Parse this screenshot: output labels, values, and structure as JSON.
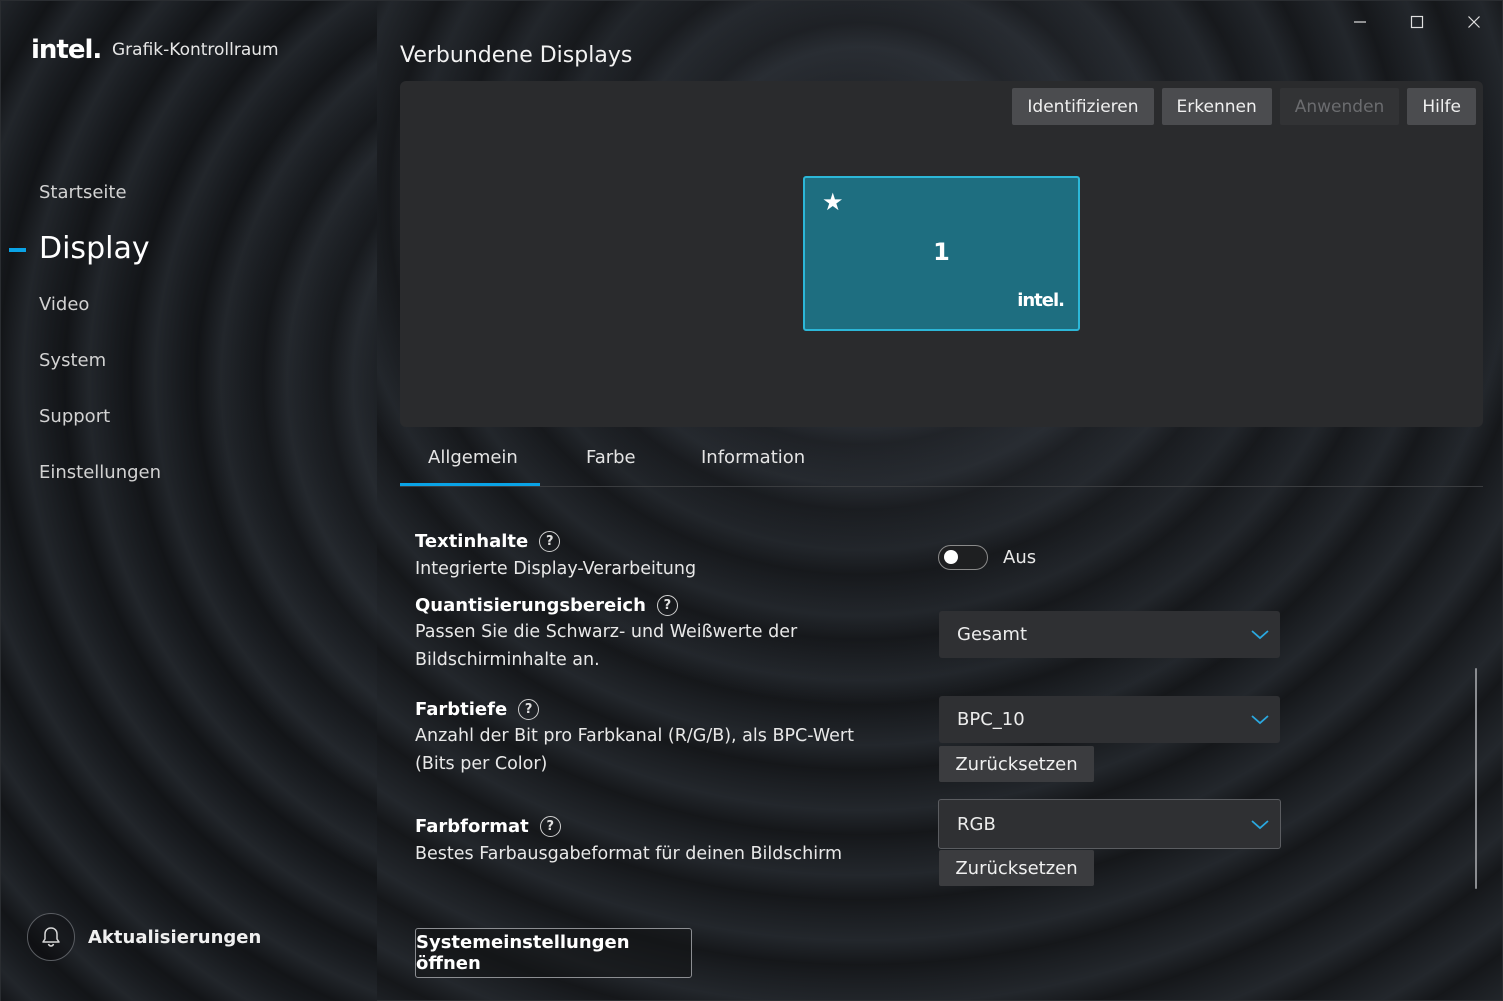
{
  "app": {
    "logo": "intel.",
    "title": "Grafik-Kontrollraum"
  },
  "window_controls": {
    "minimize": "minimize-icon",
    "maximize": "maximize-icon",
    "close": "close-icon"
  },
  "sidebar": {
    "items": [
      {
        "label": "Startseite",
        "active": false
      },
      {
        "label": "Display",
        "active": true
      },
      {
        "label": "Video",
        "active": false
      },
      {
        "label": "System",
        "active": false
      },
      {
        "label": "Support",
        "active": false
      },
      {
        "label": "Einstellungen",
        "active": false
      }
    ],
    "updates_label": "Aktualisierungen",
    "updates_icon": "bell-icon"
  },
  "main": {
    "title": "Verbundene Displays",
    "toolbar": {
      "identify": "Identifizieren",
      "detect": "Erkennen",
      "apply": "Anwenden",
      "help": "Hilfe"
    },
    "monitor": {
      "number": "1",
      "star": "★",
      "brand": "intel."
    },
    "tabs": [
      {
        "label": "Allgemein",
        "active": true
      },
      {
        "label": "Farbe",
        "active": false
      },
      {
        "label": "Information",
        "active": false
      }
    ],
    "settings": {
      "text_content": {
        "title": "Textinhalte",
        "description": "Integrierte Display-Verarbeitung",
        "toggle_state": "Aus"
      },
      "quantization": {
        "title": "Quantisierungsbereich",
        "description_line1": "Passen Sie die Schwarz- und Weißwerte der",
        "description_line2": "Bildschirminhalte an.",
        "value": "Gesamt"
      },
      "color_depth": {
        "title": "Farbtiefe",
        "description_line1": "Anzahl der Bit pro Farbkanal (R/G/B), als BPC-Wert",
        "description_line2": "(Bits per Color)",
        "value": "BPC_10",
        "reset": "Zurücksetzen"
      },
      "color_format": {
        "title": "Farbformat",
        "description": "Bestes Farbausgabeformat für deinen Bildschirm",
        "value": "RGB",
        "reset": "Zurücksetzen"
      }
    },
    "system_settings_button": "Systemeinstellungen öffnen"
  },
  "colors": {
    "accent": "#0aa3e6",
    "monitor_fill": "#1e6e80",
    "monitor_border": "#2cb7d8"
  }
}
